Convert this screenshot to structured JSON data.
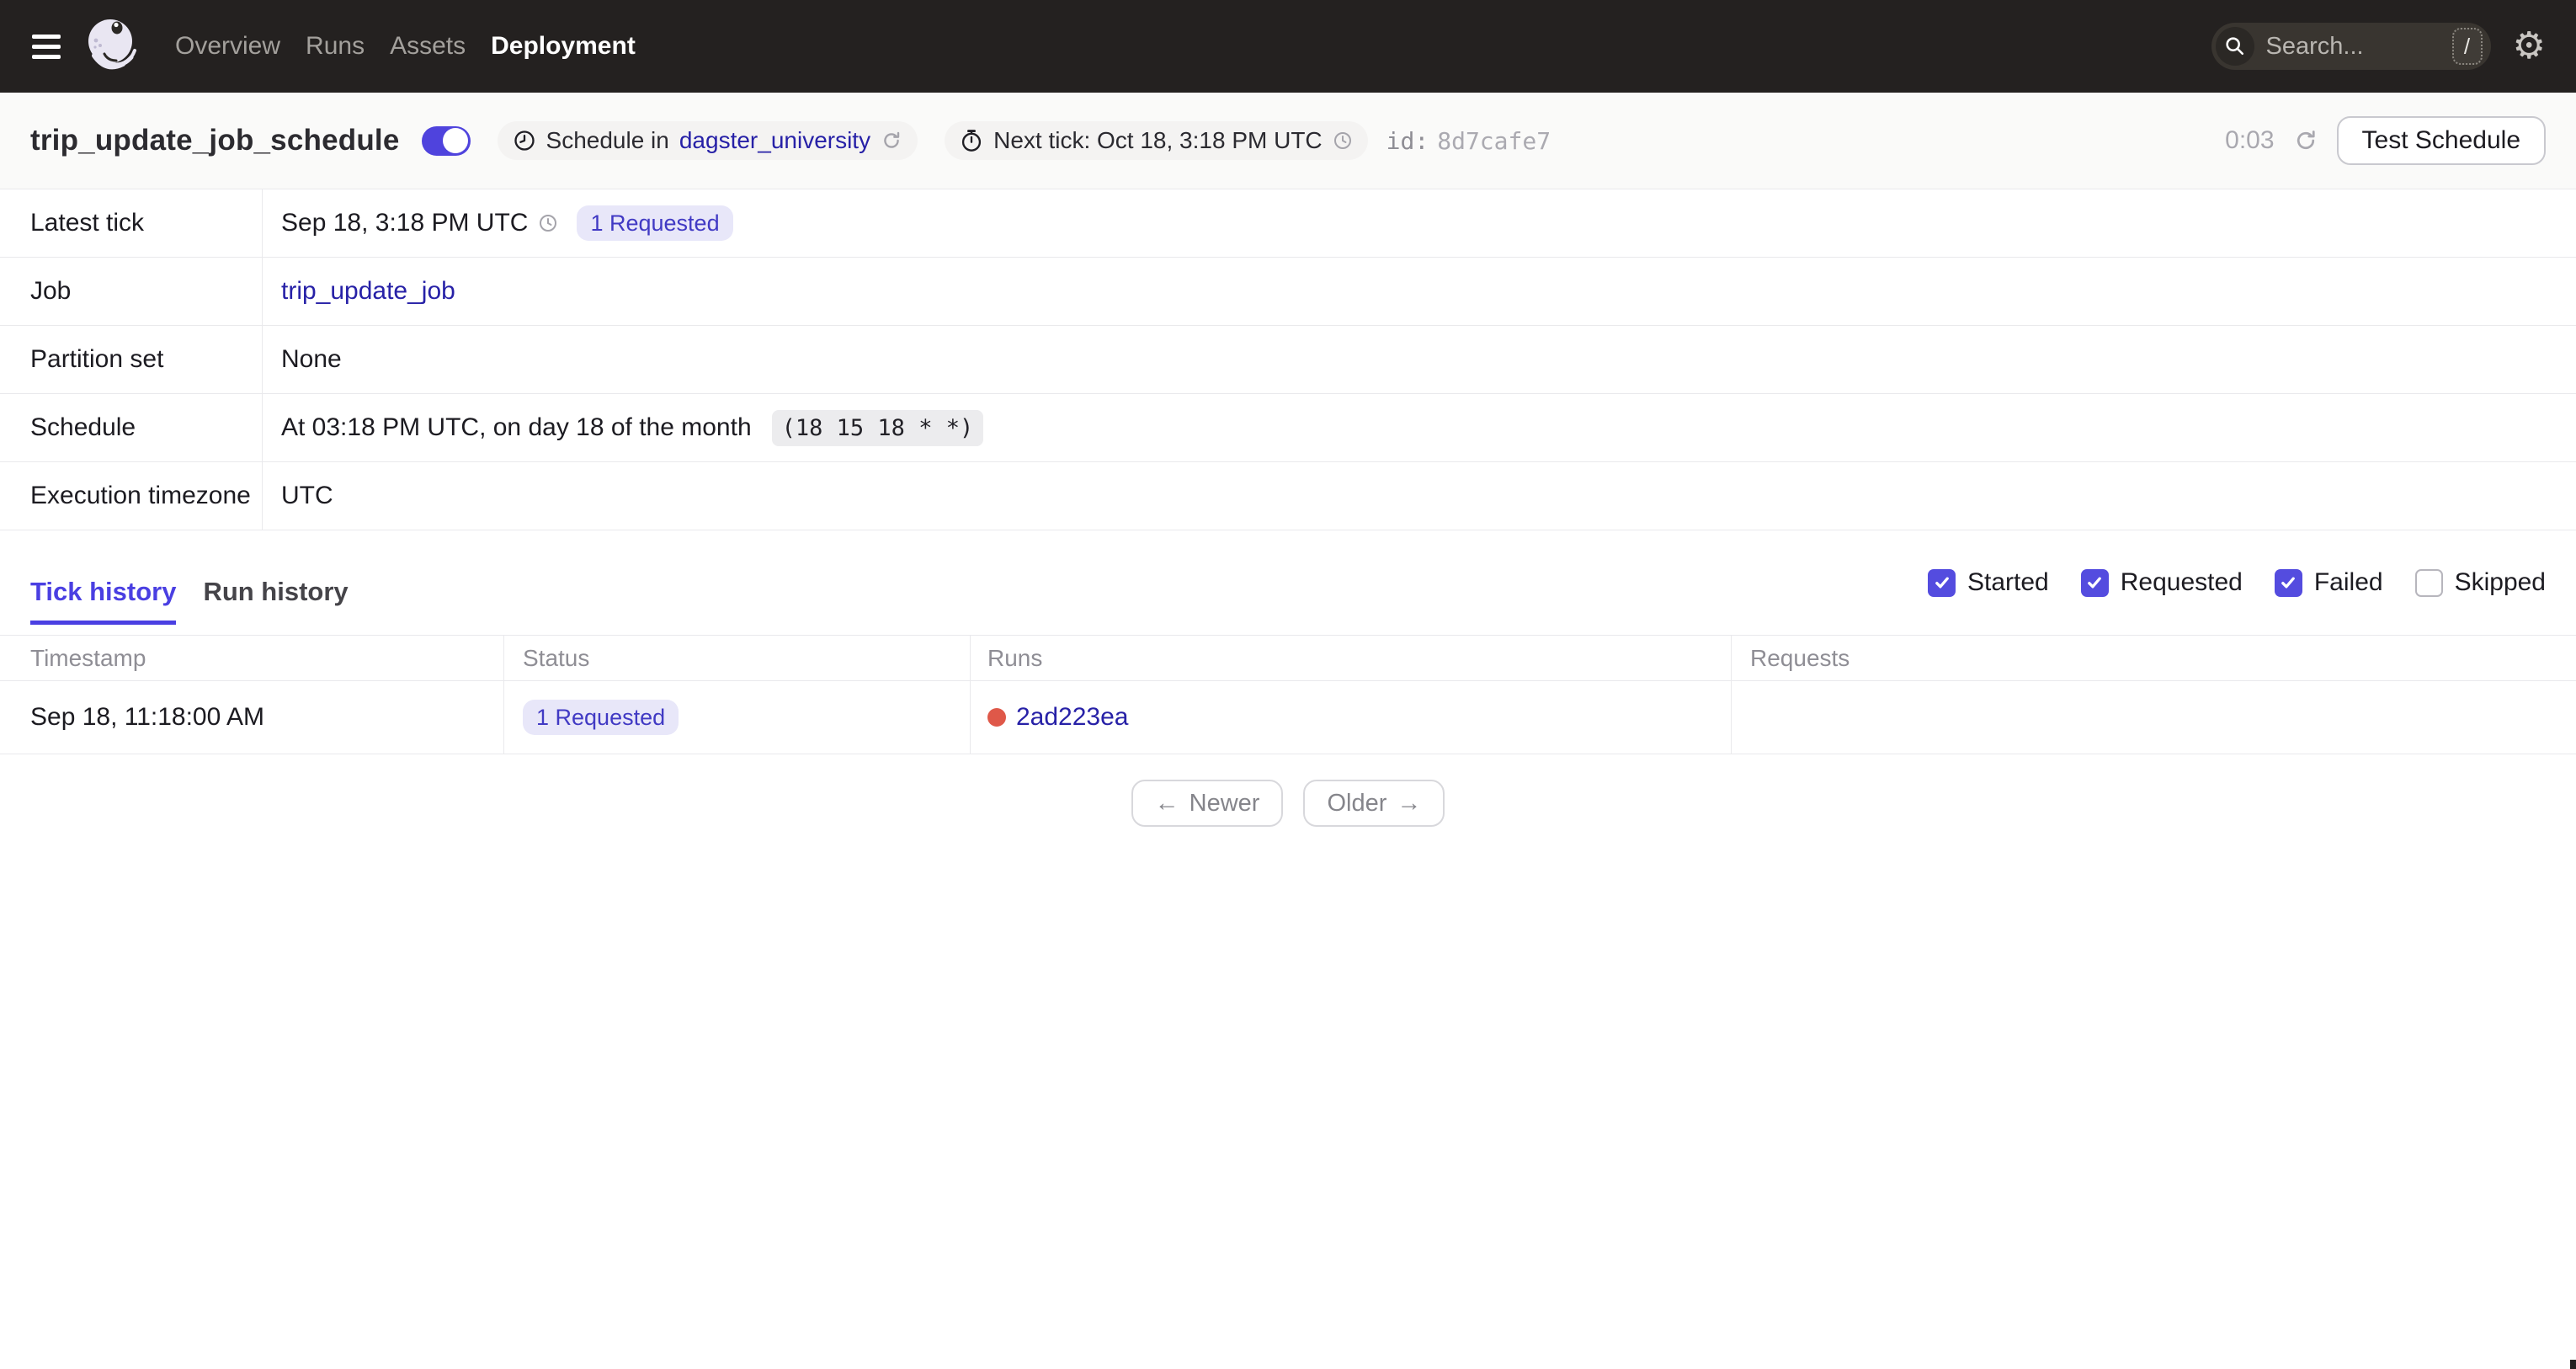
{
  "nav": {
    "items": [
      {
        "label": "Overview",
        "active": "false"
      },
      {
        "label": "Runs",
        "active": "false"
      },
      {
        "label": "Assets",
        "active": "false"
      },
      {
        "label": "Deployment",
        "active": "true"
      }
    ],
    "search": {
      "placeholder": "Search...",
      "shortcut": "/"
    }
  },
  "header": {
    "title": "trip_update_job_schedule",
    "toggle_on": "true",
    "schedule_pill": {
      "prefix": "Schedule in",
      "link": "dagster_university"
    },
    "next_tick_pill": {
      "label": "Next tick: Oct 18, 3:18 PM UTC"
    },
    "id_label": "id:",
    "id_value": "8d7cafe7",
    "refresh_timer": "0:03",
    "test_button": "Test Schedule"
  },
  "details": {
    "rows": [
      {
        "label": "Latest tick",
        "value": "Sep 18, 3:18 PM UTC",
        "badge": "1 Requested"
      },
      {
        "label": "Job",
        "link": "trip_update_job"
      },
      {
        "label": "Partition set",
        "value": "None"
      },
      {
        "label": "Schedule",
        "value": "At 03:18 PM UTC, on day 18 of the month",
        "cron": "(18 15 18 * *)"
      },
      {
        "label": "Execution timezone",
        "value": "UTC"
      }
    ]
  },
  "tabs": [
    {
      "label": "Tick history",
      "active": "true"
    },
    {
      "label": "Run history",
      "active": "false"
    }
  ],
  "filters": [
    {
      "label": "Started",
      "checked": "true"
    },
    {
      "label": "Requested",
      "checked": "true"
    },
    {
      "label": "Failed",
      "checked": "true"
    },
    {
      "label": "Skipped",
      "checked": "false"
    }
  ],
  "tick_table": {
    "columns": [
      "Timestamp",
      "Status",
      "Runs",
      "Requests"
    ],
    "rows": [
      {
        "timestamp": "Sep 18, 11:18:00 AM",
        "status_badge": "1 Requested",
        "run_id": "2ad223ea",
        "requests": ""
      }
    ]
  },
  "pagination": {
    "newer": "Newer",
    "older": "Older"
  },
  "icons": {
    "gear": "⚙",
    "arrow_left": "←",
    "arrow_right": "→"
  },
  "colors": {
    "nav_bg": "#242120",
    "accent": "#4f43dd",
    "tab_active": "#4a3fe2",
    "checkbox": "#544cdf",
    "link": "#2721a7",
    "badge_bg": "#e8e7f9",
    "badge_text": "#413ac4",
    "run_dot_red": "#df5849",
    "border": "#e9e9ec",
    "title_row_bg": "#fafaf9"
  }
}
